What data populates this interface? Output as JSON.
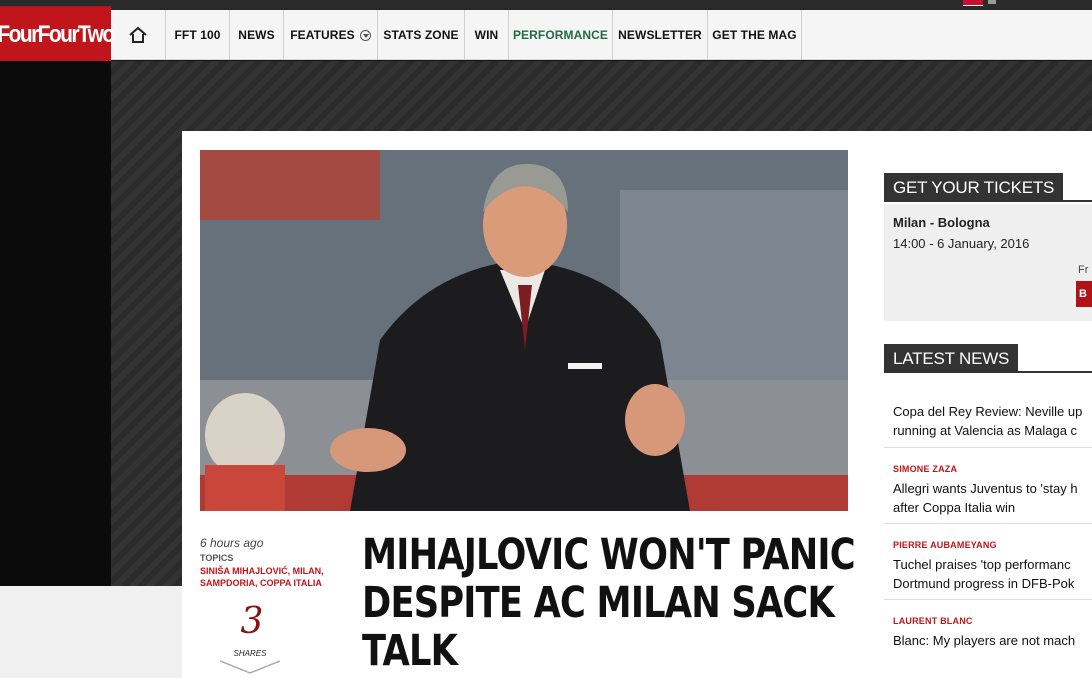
{
  "site": {
    "logo_text": "FourFourTwo",
    "brand_color": "#c1151c"
  },
  "nav": {
    "items": [
      {
        "label": "FFT 100"
      },
      {
        "label": "NEWS"
      },
      {
        "label": "FEATURES"
      },
      {
        "label": "STATS ZONE"
      },
      {
        "label": "WIN"
      },
      {
        "label": "PERFORMANCE"
      },
      {
        "label": "NEWSLETTER"
      },
      {
        "label": "GET THE MAG"
      }
    ],
    "home_icon": "home-icon",
    "active_color": "#1f6b45"
  },
  "article": {
    "time": "6 hours ago",
    "topics_label": "TOPICS",
    "topics": "SINIŠA MIHAJLOVIĆ, MILAN, SAMPDORIA, COPPA ITALIA",
    "shares_count": "3",
    "shares_label": "SHARES",
    "headline_lines": [
      "MIHAJLOVIC WON'T PANIC",
      "DESPITE AC MILAN SACK",
      "TALK"
    ]
  },
  "sidebar": {
    "tickets": {
      "heading": "GET YOUR TICKETS",
      "match": "Milan - Bologna",
      "date": "14:00 - 6 January, 2016",
      "from_text": "Fr",
      "button_text": "B"
    },
    "latest": {
      "heading": "LATEST NEWS",
      "items": [
        {
          "tag": "",
          "line1": "Copa del Rey Review: Neville up",
          "line2": "running at Valencia as Malaga c"
        },
        {
          "tag": "SIMONE ZAZA",
          "line1": "Allegri wants Juventus to 'stay h",
          "line2": "after Coppa Italia win"
        },
        {
          "tag": "PIERRE AUBAMEYANG",
          "line1": "Tuchel praises 'top performanc",
          "line2": "Dortmund progress in DFB-Pok"
        },
        {
          "tag": "LAURENT BLANC",
          "line1": "Blanc: My players are not mach",
          "line2": ""
        }
      ]
    }
  }
}
